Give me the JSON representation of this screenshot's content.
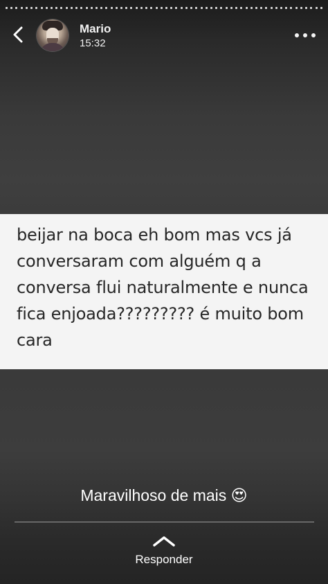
{
  "header": {
    "user_name": "Mario",
    "timestamp": "15:32",
    "icons": [
      "chevron-left-icon",
      "avatar",
      "more-icon"
    ]
  },
  "post": {
    "text": "beijar na boca eh bom mas vcs já conversaram com alguém q a conversa flui naturalmente e nunca fica enjoada????????? é muito bom cara"
  },
  "caption": {
    "text": "Maravilhoso de mais 😍"
  },
  "reply": {
    "label": "Responder",
    "icon": "chevron-up-icon"
  },
  "colors": {
    "background": "#3a3a3a",
    "post_background": "#f4f4f4",
    "post_text": "#262626",
    "text_primary": "#ffffff"
  }
}
